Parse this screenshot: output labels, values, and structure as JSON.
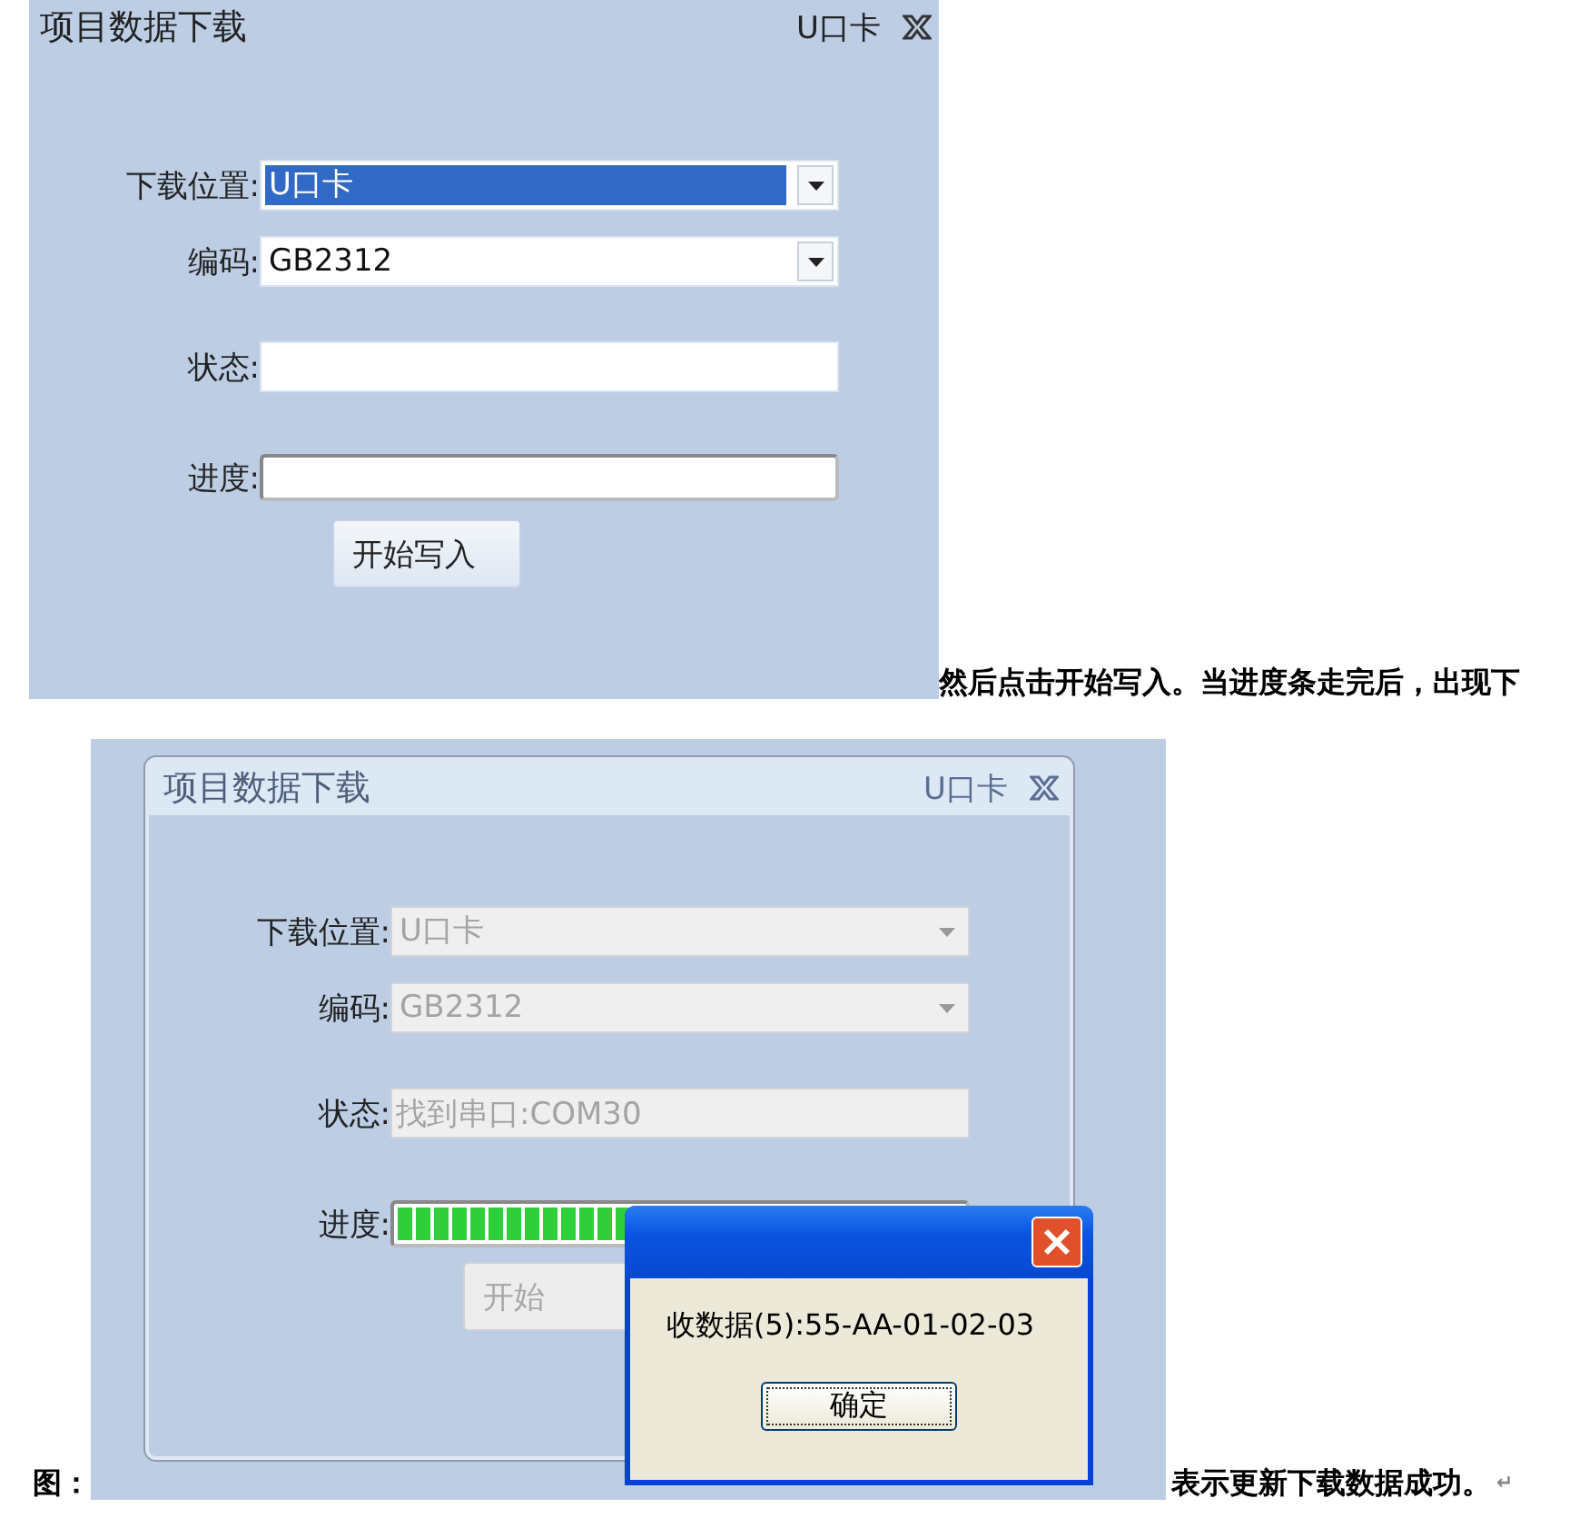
{
  "screenshot_1": {
    "title": "项目数据下载",
    "device": "U口卡",
    "framed": false,
    "disabled": false,
    "fields": [
      {
        "kind": "dropdown",
        "label": "下载位置:",
        "value": "U口卡",
        "highlighted": true
      },
      {
        "kind": "dropdown",
        "label": "编码:",
        "value": "GB2312",
        "highlighted": false
      },
      {
        "kind": "text",
        "label": "状态:"
      },
      {
        "kind": "progress",
        "label": "进度:",
        "level": 0
      }
    ],
    "button": "开始写入"
  },
  "text_1": "然后点击开始写入。当进度条走完后，出现下",
  "text_2": "图：",
  "screenshot_2": {
    "title": "项目数据下载",
    "device": "U口卡",
    "framed": true,
    "disabled": true,
    "fields": [
      {
        "kind": "dropdown",
        "label": "下载位置:",
        "value": "U口卡",
        "highlighted": false
      },
      {
        "kind": "dropdown",
        "label": "编码:",
        "value": "GB2312",
        "highlighted": false
      },
      {
        "kind": "text",
        "label": "状态:",
        "value": "找到串口:COM30"
      },
      {
        "kind": "progress",
        "label": "进度:",
        "level": 1
      }
    ],
    "button": "开始",
    "message_box": {
      "text": "收数据(5):55-AA-01-02-03",
      "button": "确定"
    }
  },
  "text_3": "表示更新下载数据成功。",
  "paragraph_mark": "↵"
}
